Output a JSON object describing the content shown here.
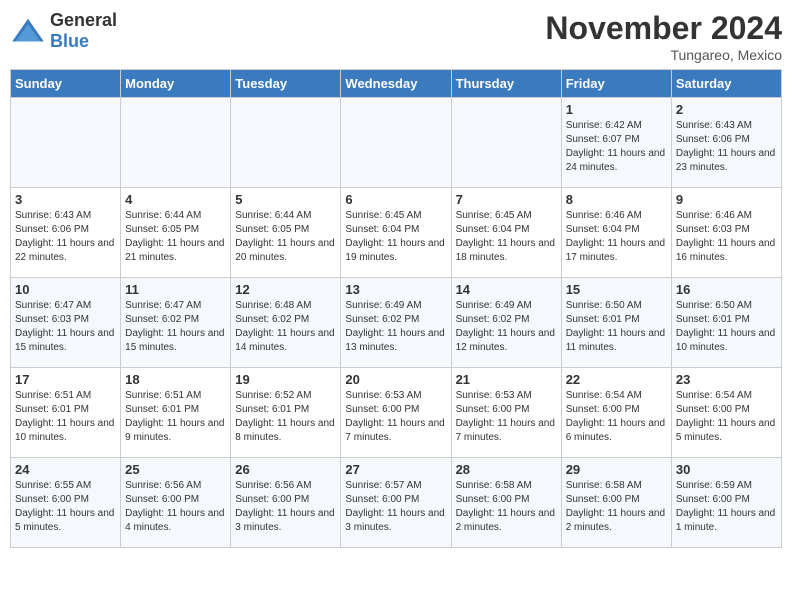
{
  "logo": {
    "general": "General",
    "blue": "Blue"
  },
  "header": {
    "month_year": "November 2024",
    "location": "Tungareo, Mexico"
  },
  "days_of_week": [
    "Sunday",
    "Monday",
    "Tuesday",
    "Wednesday",
    "Thursday",
    "Friday",
    "Saturday"
  ],
  "weeks": [
    [
      {
        "day": "",
        "info": ""
      },
      {
        "day": "",
        "info": ""
      },
      {
        "day": "",
        "info": ""
      },
      {
        "day": "",
        "info": ""
      },
      {
        "day": "",
        "info": ""
      },
      {
        "day": "1",
        "info": "Sunrise: 6:42 AM\nSunset: 6:07 PM\nDaylight: 11 hours and 24 minutes."
      },
      {
        "day": "2",
        "info": "Sunrise: 6:43 AM\nSunset: 6:06 PM\nDaylight: 11 hours and 23 minutes."
      }
    ],
    [
      {
        "day": "3",
        "info": "Sunrise: 6:43 AM\nSunset: 6:06 PM\nDaylight: 11 hours and 22 minutes."
      },
      {
        "day": "4",
        "info": "Sunrise: 6:44 AM\nSunset: 6:05 PM\nDaylight: 11 hours and 21 minutes."
      },
      {
        "day": "5",
        "info": "Sunrise: 6:44 AM\nSunset: 6:05 PM\nDaylight: 11 hours and 20 minutes."
      },
      {
        "day": "6",
        "info": "Sunrise: 6:45 AM\nSunset: 6:04 PM\nDaylight: 11 hours and 19 minutes."
      },
      {
        "day": "7",
        "info": "Sunrise: 6:45 AM\nSunset: 6:04 PM\nDaylight: 11 hours and 18 minutes."
      },
      {
        "day": "8",
        "info": "Sunrise: 6:46 AM\nSunset: 6:04 PM\nDaylight: 11 hours and 17 minutes."
      },
      {
        "day": "9",
        "info": "Sunrise: 6:46 AM\nSunset: 6:03 PM\nDaylight: 11 hours and 16 minutes."
      }
    ],
    [
      {
        "day": "10",
        "info": "Sunrise: 6:47 AM\nSunset: 6:03 PM\nDaylight: 11 hours and 15 minutes."
      },
      {
        "day": "11",
        "info": "Sunrise: 6:47 AM\nSunset: 6:02 PM\nDaylight: 11 hours and 15 minutes."
      },
      {
        "day": "12",
        "info": "Sunrise: 6:48 AM\nSunset: 6:02 PM\nDaylight: 11 hours and 14 minutes."
      },
      {
        "day": "13",
        "info": "Sunrise: 6:49 AM\nSunset: 6:02 PM\nDaylight: 11 hours and 13 minutes."
      },
      {
        "day": "14",
        "info": "Sunrise: 6:49 AM\nSunset: 6:02 PM\nDaylight: 11 hours and 12 minutes."
      },
      {
        "day": "15",
        "info": "Sunrise: 6:50 AM\nSunset: 6:01 PM\nDaylight: 11 hours and 11 minutes."
      },
      {
        "day": "16",
        "info": "Sunrise: 6:50 AM\nSunset: 6:01 PM\nDaylight: 11 hours and 10 minutes."
      }
    ],
    [
      {
        "day": "17",
        "info": "Sunrise: 6:51 AM\nSunset: 6:01 PM\nDaylight: 11 hours and 10 minutes."
      },
      {
        "day": "18",
        "info": "Sunrise: 6:51 AM\nSunset: 6:01 PM\nDaylight: 11 hours and 9 minutes."
      },
      {
        "day": "19",
        "info": "Sunrise: 6:52 AM\nSunset: 6:01 PM\nDaylight: 11 hours and 8 minutes."
      },
      {
        "day": "20",
        "info": "Sunrise: 6:53 AM\nSunset: 6:00 PM\nDaylight: 11 hours and 7 minutes."
      },
      {
        "day": "21",
        "info": "Sunrise: 6:53 AM\nSunset: 6:00 PM\nDaylight: 11 hours and 7 minutes."
      },
      {
        "day": "22",
        "info": "Sunrise: 6:54 AM\nSunset: 6:00 PM\nDaylight: 11 hours and 6 minutes."
      },
      {
        "day": "23",
        "info": "Sunrise: 6:54 AM\nSunset: 6:00 PM\nDaylight: 11 hours and 5 minutes."
      }
    ],
    [
      {
        "day": "24",
        "info": "Sunrise: 6:55 AM\nSunset: 6:00 PM\nDaylight: 11 hours and 5 minutes."
      },
      {
        "day": "25",
        "info": "Sunrise: 6:56 AM\nSunset: 6:00 PM\nDaylight: 11 hours and 4 minutes."
      },
      {
        "day": "26",
        "info": "Sunrise: 6:56 AM\nSunset: 6:00 PM\nDaylight: 11 hours and 3 minutes."
      },
      {
        "day": "27",
        "info": "Sunrise: 6:57 AM\nSunset: 6:00 PM\nDaylight: 11 hours and 3 minutes."
      },
      {
        "day": "28",
        "info": "Sunrise: 6:58 AM\nSunset: 6:00 PM\nDaylight: 11 hours and 2 minutes."
      },
      {
        "day": "29",
        "info": "Sunrise: 6:58 AM\nSunset: 6:00 PM\nDaylight: 11 hours and 2 minutes."
      },
      {
        "day": "30",
        "info": "Sunrise: 6:59 AM\nSunset: 6:00 PM\nDaylight: 11 hours and 1 minute."
      }
    ]
  ]
}
